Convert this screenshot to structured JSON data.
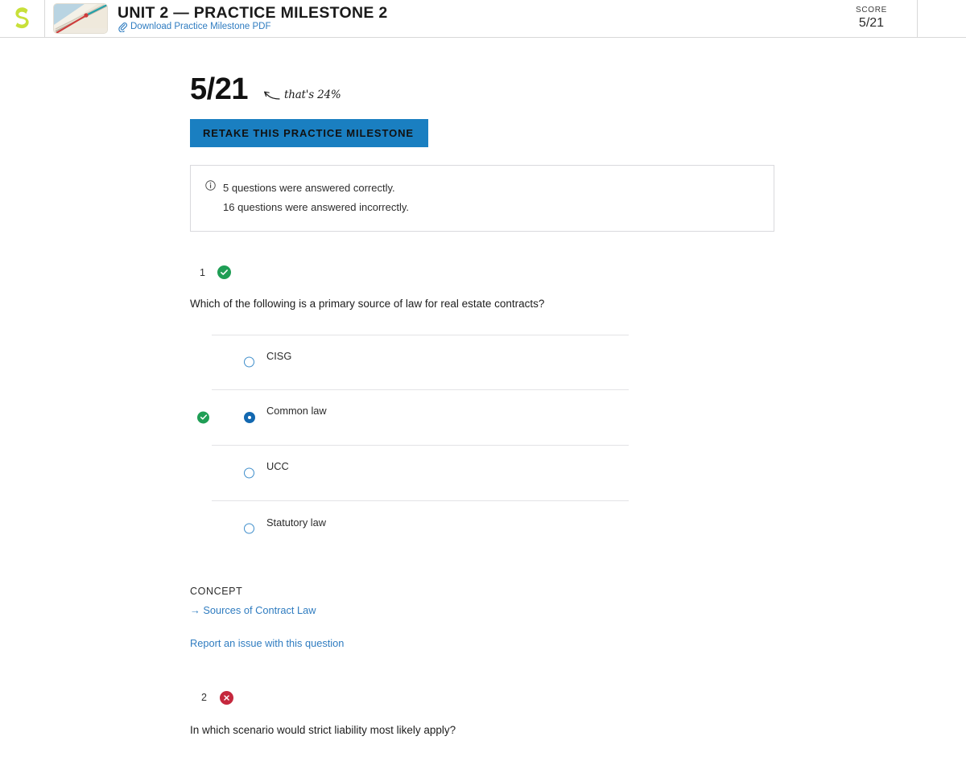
{
  "header": {
    "logo_name": "sophia-logo",
    "thumbnail_name": "course-thumbnail",
    "unit_title": "UNIT 2 — PRACTICE MILESTONE 2",
    "download_link": "Download Practice Milestone PDF",
    "attachment_icon": "paperclip-icon",
    "score_label": "SCORE",
    "score_value": "5/21"
  },
  "results": {
    "big_score": "5/21",
    "annotation": "that's 24%",
    "annotation_arrow_icon": "curved-left-arrow-icon",
    "retake_button": "RETAKE THIS PRACTICE MILESTONE",
    "info_icon": "info-circle-icon",
    "correct_line": "5 questions were answered correctly.",
    "incorrect_line": "16 questions were answered incorrectly."
  },
  "questions": [
    {
      "number": "1",
      "status": "correct",
      "status_icon": "check-circle-icon",
      "text": "Which of the following is a primary source of law for real estate contracts?",
      "options": [
        {
          "label": "CISG",
          "selected": false,
          "marked_correct": false
        },
        {
          "label": "Common law",
          "selected": true,
          "marked_correct": true
        },
        {
          "label": "UCC",
          "selected": false,
          "marked_correct": false
        },
        {
          "label": "Statutory law",
          "selected": false,
          "marked_correct": false
        }
      ],
      "concept_kicker": "CONCEPT",
      "concept_link": "Sources of Contract Law",
      "report_link": "Report an issue with this question"
    },
    {
      "number": "2",
      "status": "incorrect",
      "status_icon": "x-circle-icon",
      "text": "In which scenario would strict liability most likely apply?"
    }
  ],
  "colors": {
    "accent_blue": "#1a7fc1",
    "link_blue": "#2f7cc0",
    "correct_green": "#1f9e55",
    "incorrect_red": "#c5283d",
    "logo_green": "#c8e039"
  }
}
